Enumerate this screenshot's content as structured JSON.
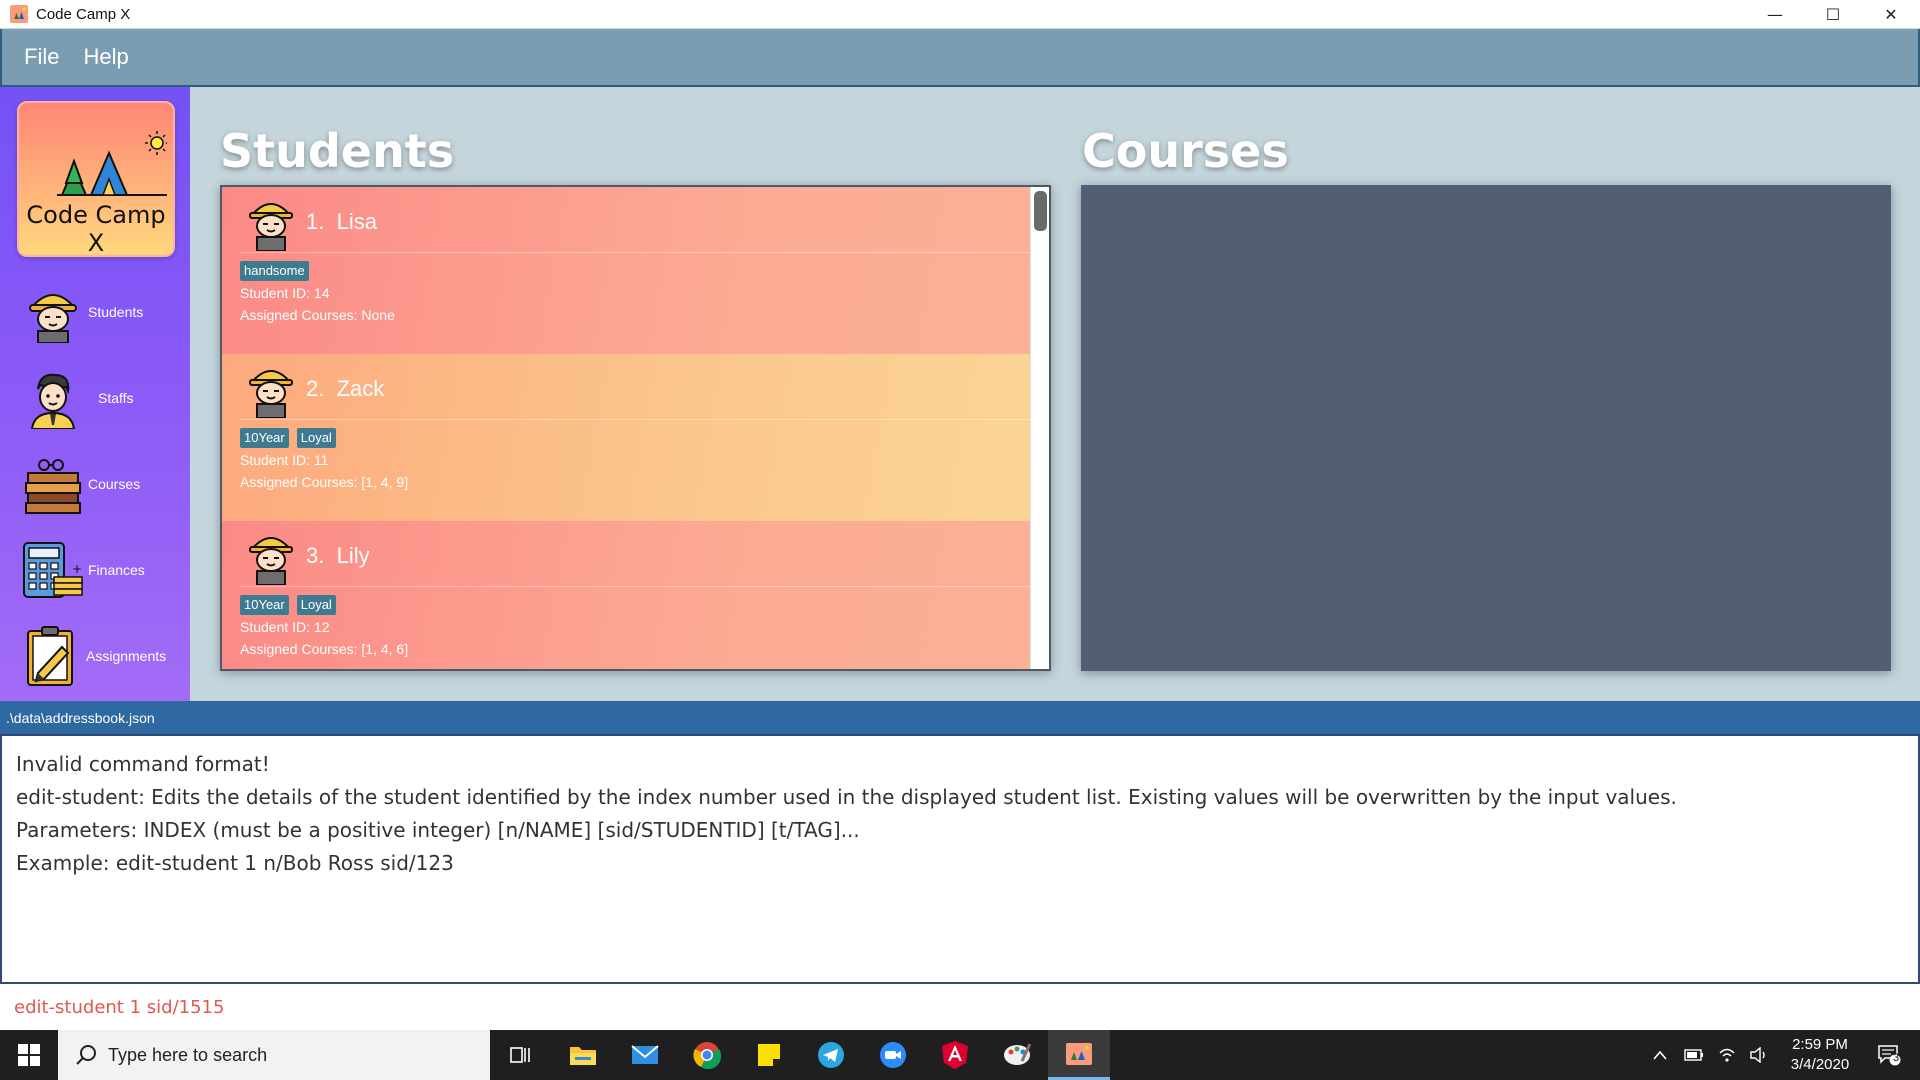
{
  "window": {
    "title": "Code Camp X",
    "controls": [
      "—",
      "☐",
      "✕"
    ]
  },
  "menu": {
    "items": [
      "File",
      "Help"
    ]
  },
  "sidebar": {
    "logo_text": "Code Camp X",
    "items": [
      {
        "label": "Students",
        "icon": "student-icon"
      },
      {
        "label": "Staffs",
        "icon": "staff-icon"
      },
      {
        "label": "Courses",
        "icon": "courses-icon"
      },
      {
        "label": "Finances",
        "icon": "finances-icon"
      },
      {
        "label": "Assignments",
        "icon": "assignments-icon"
      }
    ]
  },
  "students": {
    "title": "Students",
    "list": [
      {
        "index": "1.",
        "name": "Lisa",
        "tags": [
          "handsome"
        ],
        "student_id": "Student ID: 14",
        "courses": "Assigned Courses: None"
      },
      {
        "index": "2.",
        "name": "Zack",
        "tags": [
          "10Year",
          "Loyal"
        ],
        "student_id": "Student ID: 11",
        "courses": "Assigned Courses: [1, 4, 9]"
      },
      {
        "index": "3.",
        "name": "Lily",
        "tags": [
          "10Year",
          "Loyal"
        ],
        "student_id": "Student ID: 12",
        "courses": "Assigned Courses: [1, 4, 6]"
      }
    ]
  },
  "courses": {
    "title": "Courses"
  },
  "status": {
    "path": ".\\data\\addressbook.json"
  },
  "result": {
    "lines": [
      "Invalid command format!",
      "edit-student: Edits the details of the student identified by the index number used in the displayed student list. Existing values will be overwritten by the input values.",
      "Parameters: INDEX (must be a positive integer) [n/NAME] [sid/STUDENTID] [t/TAG]...",
      "Example: edit-student 1 n/Bob Ross sid/123"
    ]
  },
  "command": {
    "value": "edit-student 1 sid/1515"
  },
  "taskbar": {
    "search_placeholder": "Type here to search",
    "time": "2:59 PM",
    "date": "3/4/2020",
    "notification_count": "3"
  }
}
